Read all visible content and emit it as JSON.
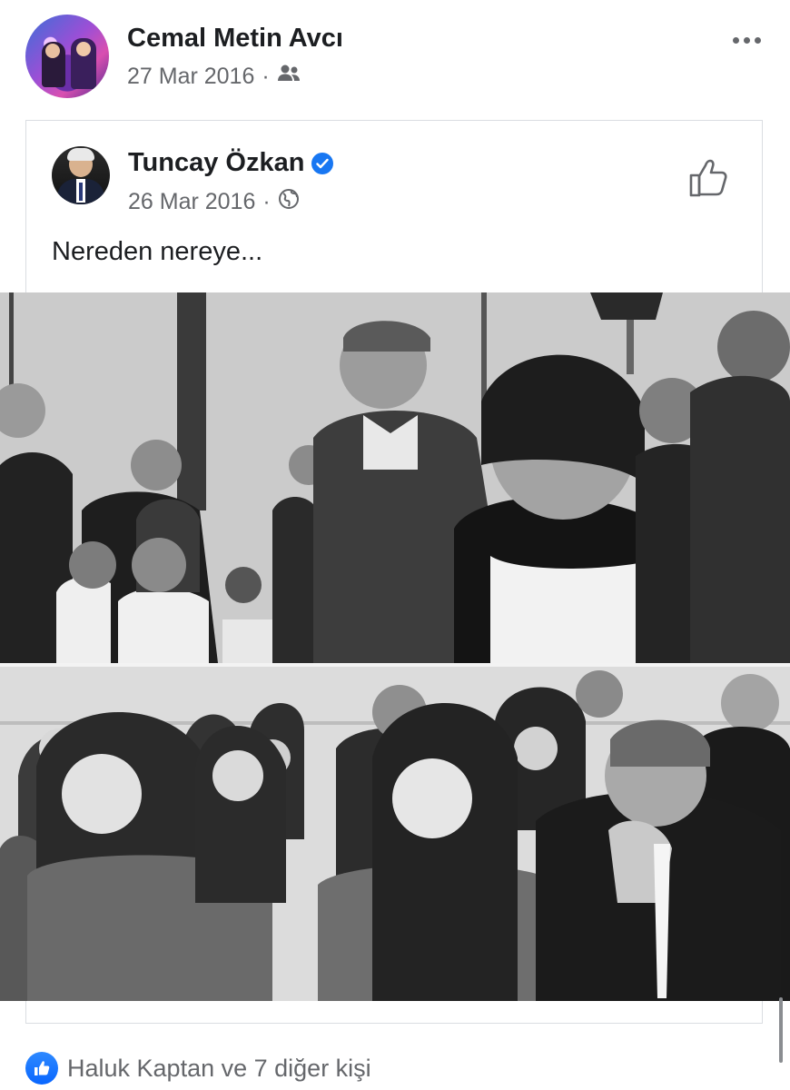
{
  "post": {
    "author": "Cemal Metin Avcı",
    "date": "27 Mar 2016",
    "separator": "·",
    "audience_icon": "friends-icon"
  },
  "shared": {
    "author": "Tuncay Özkan",
    "verified": true,
    "date": "26 Mar 2016",
    "separator": "·",
    "audience_icon": "globe-icon",
    "text": "Nereden nereye..."
  },
  "reactions": {
    "summary": "Haluk Kaptan ve 7 diğer kişi",
    "icon": "like-icon"
  },
  "colors": {
    "accent": "#1877f2",
    "secondary_text": "#65676b",
    "primary_text": "#1c1e21",
    "border": "#dadde1"
  }
}
